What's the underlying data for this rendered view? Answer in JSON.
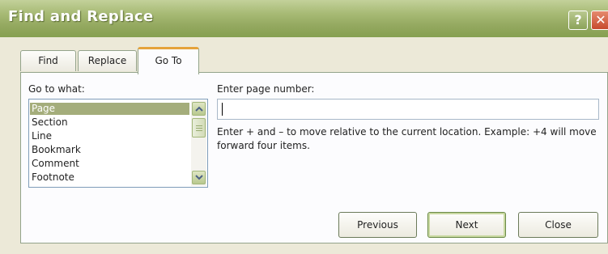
{
  "window": {
    "title": "Find and Replace",
    "help_glyph": "?",
    "close_glyph": "✕"
  },
  "tabs": [
    {
      "label": "Find",
      "active": false
    },
    {
      "label": "Replace",
      "active": false
    },
    {
      "label": "Go To",
      "active": true
    }
  ],
  "goto": {
    "label": "Go to what:",
    "items": [
      "Page",
      "Section",
      "Line",
      "Bookmark",
      "Comment",
      "Footnote"
    ],
    "selected_index": 0
  },
  "page_number": {
    "label": "Enter page number:",
    "value": "",
    "help": "Enter + and – to move relative to the current location. Example: +4 will move forward four items."
  },
  "buttons": {
    "previous": "Previous",
    "next": "Next",
    "close": "Close"
  },
  "colors": {
    "title_bar": "#93a85f",
    "selection": "#a4ad7b",
    "active_tab_accent": "#e5a33a"
  }
}
